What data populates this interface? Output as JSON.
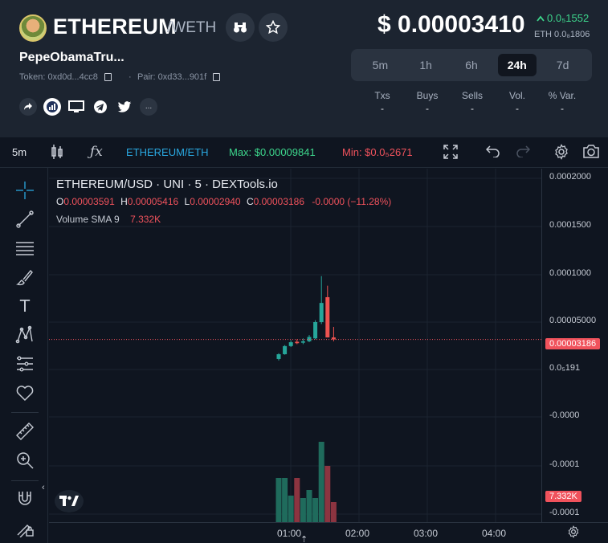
{
  "header": {
    "symbol": "ETHEREUM",
    "pair_suffix": "/WETH",
    "name": "PepeObamaTru...",
    "token_label": "Token: 0xd0d...4cc8",
    "pair_label": "Pair: 0xd33...901f",
    "price": "$ 0.00003410",
    "change": "0.0₅1552",
    "eth_price": "ETH 0.0₈1806",
    "timeframes": [
      "5m",
      "1h",
      "6h",
      "24h",
      "7d"
    ],
    "active_timeframe": "24h",
    "stats": [
      {
        "label": "Txs",
        "value": "-"
      },
      {
        "label": "Buys",
        "value": "-"
      },
      {
        "label": "Sells",
        "value": "-"
      },
      {
        "label": "Vol.",
        "value": "-"
      },
      {
        "label": "% Var.",
        "value": "-"
      }
    ],
    "socials": [
      "share-icon",
      "etherscan-icon",
      "website-icon",
      "telegram-icon",
      "twitter-icon",
      "more-icon"
    ],
    "more_label": "..."
  },
  "toolbar": {
    "interval": "5m",
    "pair": "ETHEREUM/ETH",
    "max": "Max: $0.00009841",
    "min": "Min: $0.0₅2671"
  },
  "chart": {
    "title": "ETHEREUM/USD · UNI · 5 · DEXTools.io",
    "ohlc": {
      "o_label": "O",
      "o": "0.00003591",
      "h_label": "H",
      "h": "0.00005416",
      "l_label": "L",
      "l": "0.00002940",
      "c_label": "C",
      "c": "0.00003186",
      "delta": "-0.0000 (−11.28%)"
    },
    "volume_label": "Volume SMA 9",
    "volume_value": "7.332K",
    "y_labels": [
      "0.0002000",
      "0.0001500",
      "0.0001000",
      "0.00005000",
      "0.0₅191",
      "-0.0000",
      "-0.0001",
      "-0.0001"
    ],
    "price_tag": "0.00003186",
    "volume_tag": "7.332K",
    "x_labels": [
      "01:00",
      "02:00",
      "03:00",
      "04:00"
    ],
    "colors": {
      "up": "#26a69a",
      "down": "#ef5350",
      "accent": "#2aa8e0",
      "max": "#3dd68c",
      "min": "#f0525c"
    }
  },
  "chart_data": {
    "type": "candlestick",
    "title": "ETHEREUM/USD · UNI · 5 · DEXTools.io",
    "x_ticks": [
      "01:00",
      "02:00",
      "03:00",
      "04:00"
    ],
    "candles": [
      {
        "o": 1.15e-05,
        "h": 1.75e-05,
        "l": 1e-05,
        "c": 1.65e-05,
        "vol": 0.55
      },
      {
        "o": 1.65e-05,
        "h": 2.6e-05,
        "l": 1.6e-05,
        "c": 2.5e-05,
        "vol": 0.55
      },
      {
        "o": 2.5e-05,
        "h": 3.1e-05,
        "l": 2.4e-05,
        "c": 2.9e-05,
        "vol": 0.33
      },
      {
        "o": 2.95e-05,
        "h": 3.2e-05,
        "l": 2.7e-05,
        "c": 2.8e-05,
        "vol": 0.55
      },
      {
        "o": 2.85e-05,
        "h": 3.3e-05,
        "l": 2.7e-05,
        "c": 3e-05,
        "vol": 0.3
      },
      {
        "o": 3e-05,
        "h": 3.65e-05,
        "l": 2.9e-05,
        "c": 3.45e-05,
        "vol": 0.4
      },
      {
        "o": 3.3e-05,
        "h": 5.2e-05,
        "l": 3.2e-05,
        "c": 5e-05,
        "vol": 0.3
      },
      {
        "o": 5e-05,
        "h": 9.8e-05,
        "l": 4.8e-05,
        "c": 7e-05,
        "vol": 1.0
      },
      {
        "o": 7.6e-05,
        "h": 8.8e-05,
        "l": 3.4e-05,
        "c": 3.4e-05,
        "vol": 0.7
      },
      {
        "o": 3.4e-05,
        "h": 4.5e-05,
        "l": 3e-05,
        "c": 3.19e-05,
        "vol": 0.25
      }
    ],
    "y_range": [
      -0.00012,
      0.0002
    ]
  }
}
